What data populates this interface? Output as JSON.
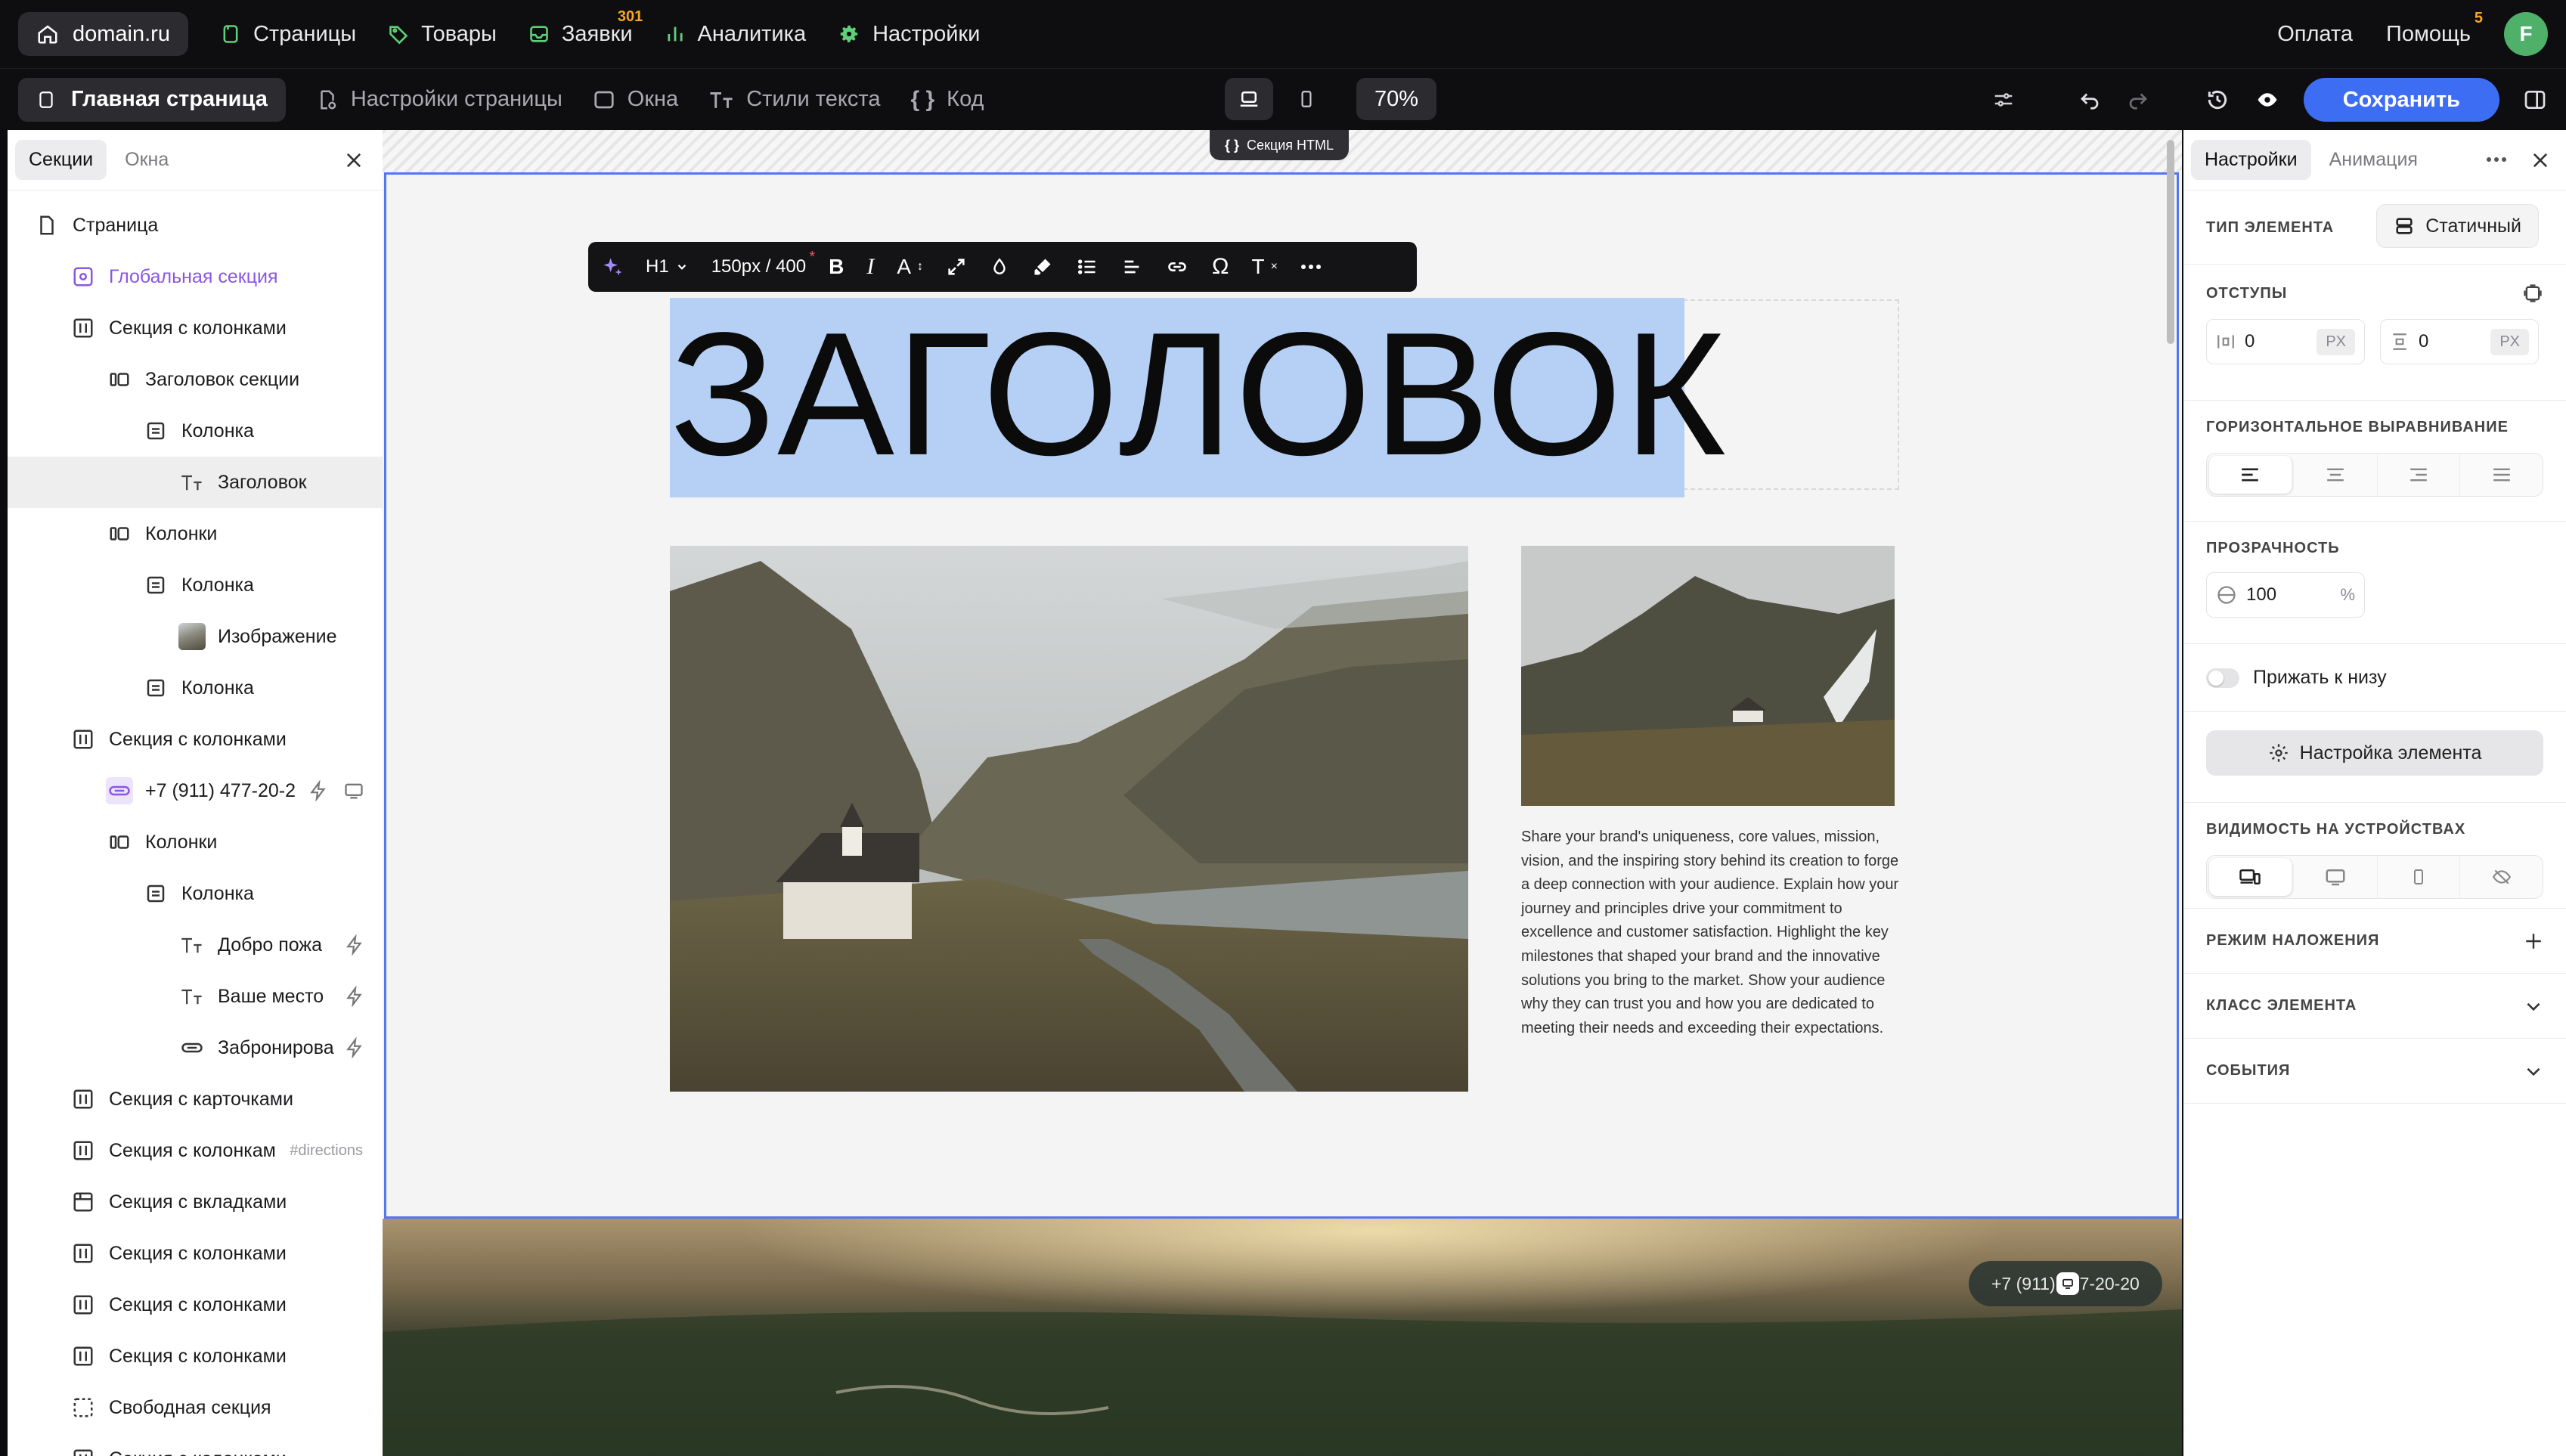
{
  "topnav": {
    "domain": "domain.ru",
    "items": [
      {
        "label": "Страницы",
        "icon": "page-icon"
      },
      {
        "label": "Товары",
        "icon": "tag-icon"
      },
      {
        "label": "Заявки",
        "icon": "inbox-icon",
        "badge": "301"
      },
      {
        "label": "Аналитика",
        "icon": "bar-chart-icon"
      },
      {
        "label": "Настройки",
        "icon": "gear-icon"
      }
    ],
    "payment": "Оплата",
    "help": "Помощь",
    "help_badge": "5",
    "avatar": "F"
  },
  "toolbar": {
    "page": "Главная страница",
    "page_settings": "Настройки страницы",
    "windows": "Окна",
    "text_styles": "Стили текста",
    "code": "Код",
    "zoom": "70%",
    "save": "Сохранить"
  },
  "left": {
    "tabs": [
      "Секции",
      "Окна"
    ],
    "tree": [
      {
        "label": "Страница",
        "indent": 0,
        "icon": "page-icon"
      },
      {
        "label": "Глобальная секция",
        "indent": 1,
        "icon": "global-section-icon",
        "purple": true
      },
      {
        "label": "Секция с колонками",
        "indent": 1,
        "icon": "columns-section-icon"
      },
      {
        "label": "Заголовок секции",
        "indent": 2,
        "icon": "columns-icon"
      },
      {
        "label": "Колонка",
        "indent": 3,
        "icon": "column-icon"
      },
      {
        "label": "Заголовок",
        "indent": 4,
        "icon": "text-icon",
        "selected": true
      },
      {
        "label": "Колонки",
        "indent": 2,
        "icon": "columns-icon"
      },
      {
        "label": "Колонка",
        "indent": 3,
        "icon": "column-icon"
      },
      {
        "label": "Изображение",
        "indent": 4,
        "icon": "image-thumb"
      },
      {
        "label": "Колонка",
        "indent": 3,
        "icon": "column-icon"
      },
      {
        "label": "Секция с колонками",
        "indent": 1,
        "icon": "columns-section-icon"
      },
      {
        "label": "+7 (911) 477-20-2",
        "indent": 2,
        "icon": "button-icon",
        "purple_icon": true,
        "actions": true
      },
      {
        "label": "Колонки",
        "indent": 2,
        "icon": "columns-icon"
      },
      {
        "label": "Колонка",
        "indent": 3,
        "icon": "column-icon"
      },
      {
        "label": "Добро пожа",
        "indent": 4,
        "icon": "text-icon",
        "bolt": true
      },
      {
        "label": "Ваше место",
        "indent": 4,
        "icon": "text-icon",
        "bolt": true
      },
      {
        "label": "Забронирова",
        "indent": 4,
        "icon": "button-icon",
        "bolt": true
      },
      {
        "label": "Секция с карточками",
        "indent": 1,
        "icon": "columns-section-icon"
      },
      {
        "label": "Секция с колонкам",
        "indent": 1,
        "icon": "columns-section-icon",
        "tag": "#directions"
      },
      {
        "label": "Секция с вкладками",
        "indent": 1,
        "icon": "tabs-section-icon"
      },
      {
        "label": "Секция с колонками",
        "indent": 1,
        "icon": "columns-section-icon"
      },
      {
        "label": "Секция с колонками",
        "indent": 1,
        "icon": "columns-section-icon"
      },
      {
        "label": "Секция с колонками",
        "indent": 1,
        "icon": "columns-section-icon"
      },
      {
        "label": "Свободная секция",
        "indent": 1,
        "icon": "free-section-icon"
      },
      {
        "label": "Секция с колонками",
        "indent": 1,
        "icon": "columns-section-icon"
      }
    ]
  },
  "canvas": {
    "html_section_tag": "Секция HTML",
    "format_bar": {
      "heading_level": "H1",
      "size": "150px / 400"
    },
    "heading": "ЗАГОЛОВОК",
    "paragraph": "Share your brand's uniqueness, core values, mission, vision, and the inspiring story behind its creation to forge a deep connection with your audience. Explain how your journey and principles drive your commitment to excellence and customer satisfaction. Highlight the key milestones that shaped your brand and the innovative solutions you bring to the market. Show your audience why they can trust you and how you are dedicated to meeting their needs and exceeding their expectations.",
    "phone_chip": "+7 (911) 477-20-20"
  },
  "right": {
    "tabs": [
      "Настройки",
      "Анимация"
    ],
    "element_type_label": "ТИП ЭЛЕМЕНТА",
    "element_type_value": "Статичный",
    "paddings_label": "ОТСТУПЫ",
    "padding_left": "0",
    "padding_top": "0",
    "unit": "PX",
    "halign_label": "ГОРИЗОНТАЛЬНОЕ ВЫРАВНИВАНИЕ",
    "opacity_label": "ПРОЗРАЧНОСТЬ",
    "opacity_value": "100",
    "opacity_unit": "%",
    "stick_bottom": "Прижать к низу",
    "element_settings": "Настройка элемента",
    "visibility_label": "ВИДИМОСТЬ НА УСТРОЙСТВАХ",
    "blend_mode": "РЕЖИМ НАЛОЖЕНИЯ",
    "element_class": "КЛАСС ЭЛЕМЕНТА",
    "events": "СОБЫТИЯ"
  },
  "colors": {
    "accent": "#3d6df2",
    "selection": "#b6d0f5",
    "purple": "#8a56e6",
    "badge": "#f5a623",
    "avatar": "#4fb06a"
  }
}
